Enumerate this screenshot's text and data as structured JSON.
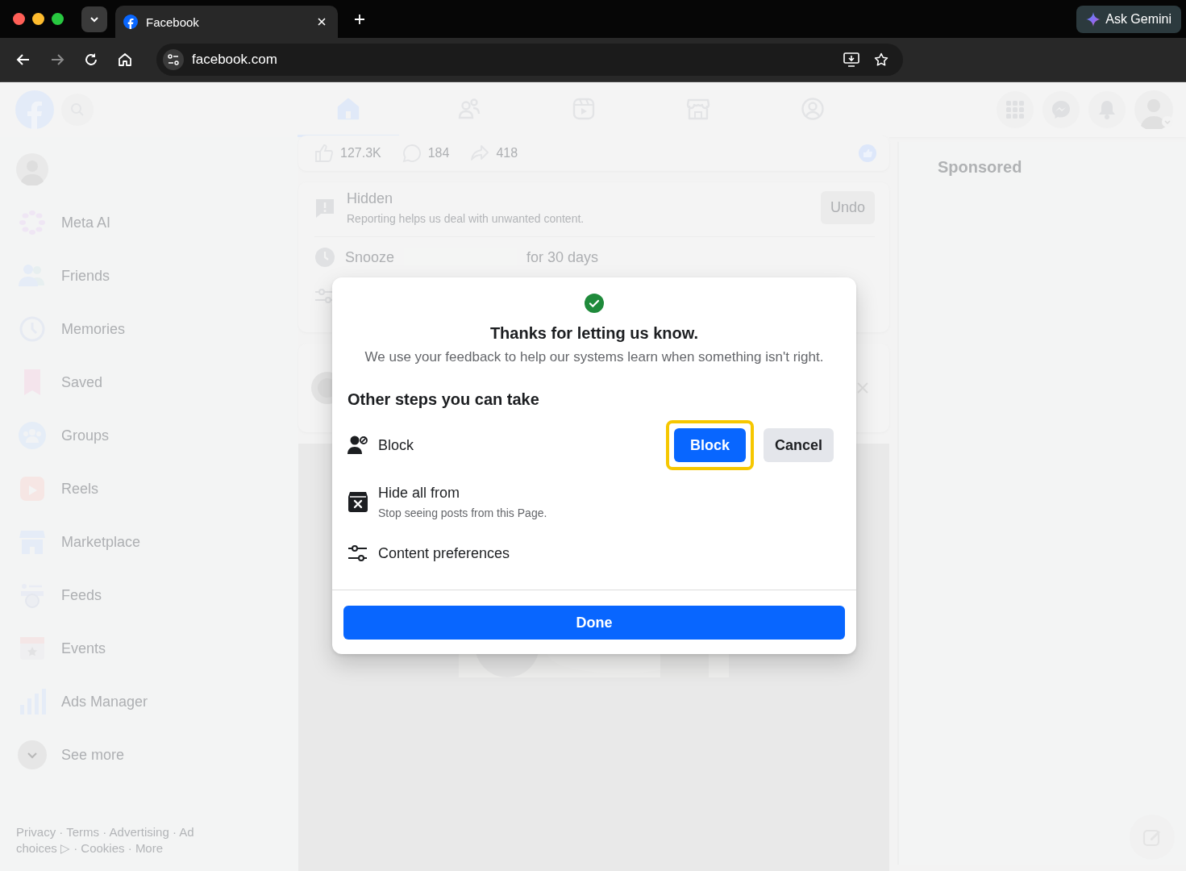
{
  "browser": {
    "tab_title": "Facebook",
    "gemini_label": "Ask Gemini",
    "url": "facebook.com",
    "forward_enabled": false
  },
  "header": {
    "nav_tabs": [
      {
        "kind": "home",
        "selected": true
      },
      {
        "kind": "friends",
        "selected": false
      },
      {
        "kind": "video",
        "selected": false
      },
      {
        "kind": "store",
        "selected": false
      },
      {
        "kind": "gaming",
        "selected": false
      }
    ]
  },
  "sidebar": {
    "items": [
      {
        "kind": "profile"
      },
      {
        "kind": "meta-ai",
        "label": "Meta AI"
      },
      {
        "kind": "friends",
        "label": "Friends"
      },
      {
        "kind": "memories",
        "label": "Memories"
      },
      {
        "kind": "saved",
        "label": "Saved"
      },
      {
        "kind": "groups",
        "label": "Groups"
      },
      {
        "kind": "reels",
        "label": "Reels"
      },
      {
        "kind": "marketplace",
        "label": "Marketplace"
      },
      {
        "kind": "feeds",
        "label": "Feeds"
      },
      {
        "kind": "events",
        "label": "Events"
      },
      {
        "kind": "ads",
        "label": "Ads Manager"
      },
      {
        "kind": "more",
        "label": "See more"
      }
    ],
    "footer": "Privacy · Terms · Advertising · Ad choices ▷ · Cookies · More"
  },
  "feed": {
    "reactions": [
      {
        "kind": "like",
        "count": "127.3K"
      },
      {
        "kind": "comment",
        "count": "184"
      },
      {
        "kind": "share",
        "count": "418"
      }
    ],
    "hidden_notice": {
      "title": "Hidden",
      "text": "Reporting helps us deal with unwanted content.",
      "action": "Undo"
    },
    "snooze": {
      "label": "Snooze",
      "suffix": "for 30 days"
    }
  },
  "right_rail": {
    "heading": "Sponsored"
  },
  "dialog": {
    "title": "Thanks for letting us know.",
    "description": "We use your feedback to help our systems learn when something isn't right.",
    "steps_heading": "Other steps you can take",
    "steps": [
      {
        "kind": "block",
        "label": "Block",
        "buttons": [
          {
            "label": "Block",
            "kind": "primary",
            "highlighted": true
          },
          {
            "label": "Cancel",
            "kind": "secondary",
            "highlighted": false
          }
        ]
      },
      {
        "kind": "hide",
        "label": "Hide all from",
        "sublabel": "Stop seeing posts from this Page."
      },
      {
        "kind": "preferences",
        "label": "Content preferences"
      }
    ],
    "done": "Done"
  }
}
